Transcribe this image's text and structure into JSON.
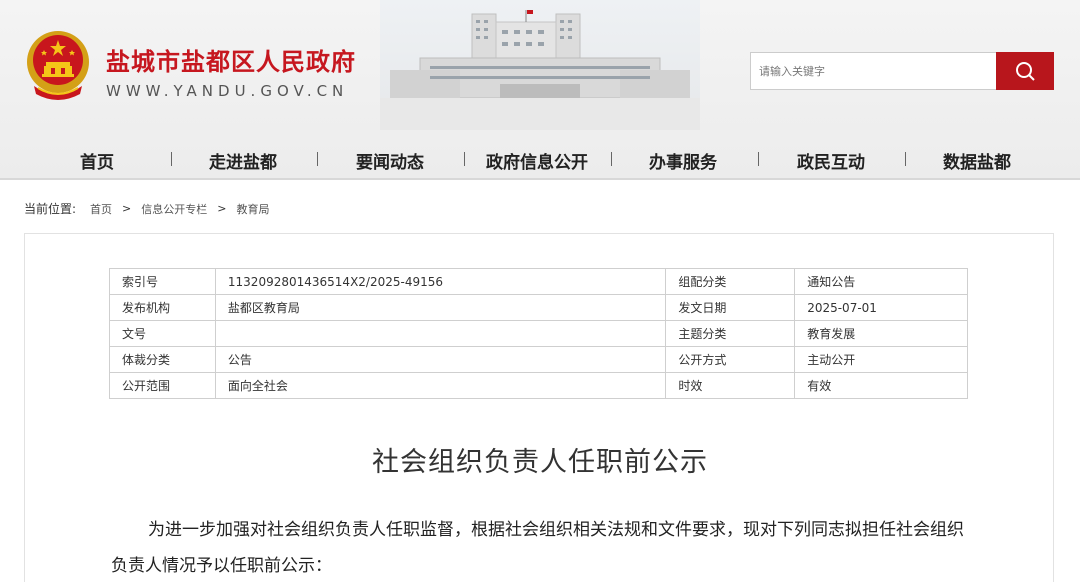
{
  "header": {
    "title": "盐城市盐都区人民政府",
    "domain": "WWW.YANDU.GOV.CN",
    "search_placeholder": "请输入关键字"
  },
  "nav": {
    "items": [
      {
        "label": "首页"
      },
      {
        "label": "走进盐都"
      },
      {
        "label": "要闻动态"
      },
      {
        "label": "政府信息公开"
      },
      {
        "label": "办事服务"
      },
      {
        "label": "政民互动"
      },
      {
        "label": "数据盐都"
      }
    ]
  },
  "breadcrumb": {
    "label": "当前位置:",
    "items": [
      "首页",
      "信息公开专栏",
      "教育局"
    ],
    "separator": ">"
  },
  "meta_table": {
    "rows": [
      [
        {
          "k": "索引号",
          "v": "1132092801436514X2/2025-49156"
        },
        {
          "k": "组配分类",
          "v": "通知公告"
        }
      ],
      [
        {
          "k": "发布机构",
          "v": "盐都区教育局"
        },
        {
          "k": "发文日期",
          "v": "2025-07-01"
        }
      ],
      [
        {
          "k": "文号",
          "v": ""
        },
        {
          "k": "主题分类",
          "v": "教育发展"
        }
      ],
      [
        {
          "k": "体裁分类",
          "v": "公告"
        },
        {
          "k": "公开方式",
          "v": "主动公开"
        }
      ],
      [
        {
          "k": "公开范围",
          "v": "面向全社会"
        },
        {
          "k": "时效",
          "v": "有效"
        }
      ]
    ]
  },
  "article": {
    "title": "社会组织负责人任职前公示",
    "body": "为进一步加强对社会组织负责人任职监督，根据社会组织相关法规和文件要求，现对下列同志拟担任社会组织负责人情况予以任职前公示："
  },
  "colors": {
    "brand_red": "#c6171f",
    "search_button": "#b8161c",
    "header_bg": "#f0f0f0"
  },
  "icons": {
    "emblem": "national-emblem-icon",
    "search": "search-icon"
  }
}
